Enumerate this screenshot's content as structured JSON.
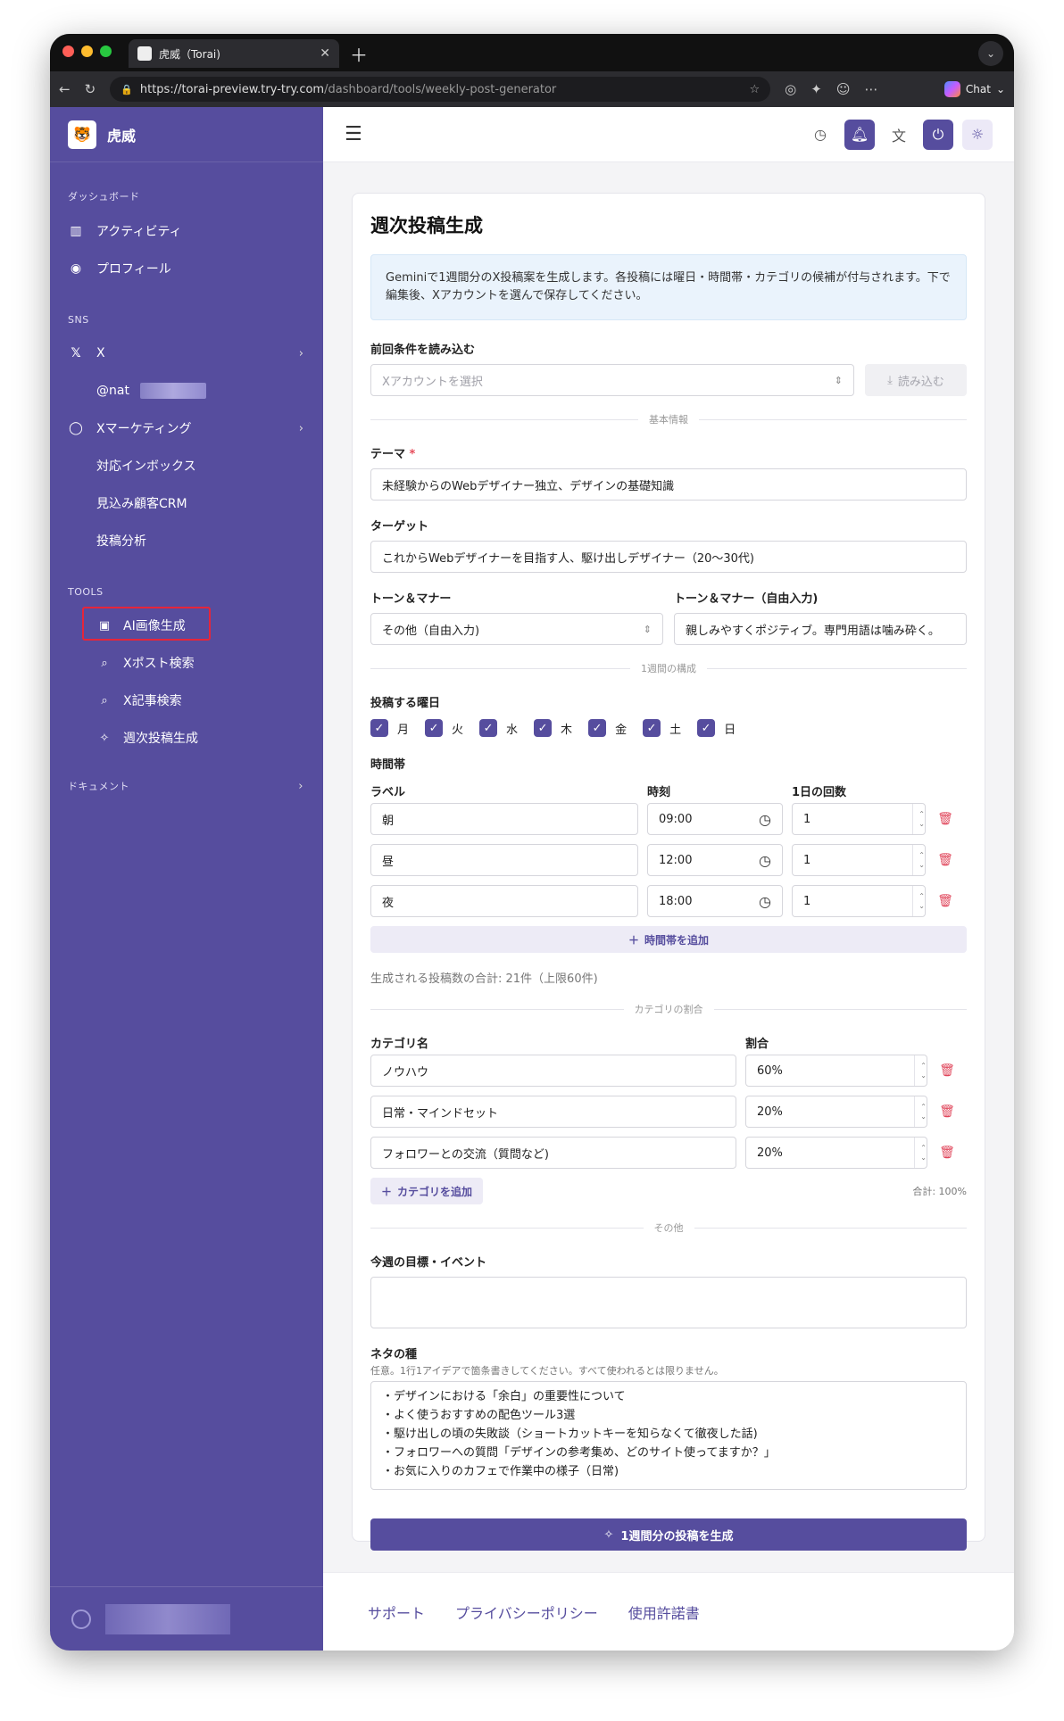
{
  "browser": {
    "tab_title": "虎威（Torai)",
    "url_host": "https://torai-preview.try-try.com",
    "url_path": "/dashboard/tools/weekly-post-generator",
    "chat_label": "Chat"
  },
  "sidebar": {
    "brand": "虎威",
    "section_dashboard": "ダッシュボード",
    "activity": "アクティビティ",
    "profile": "プロフィール",
    "section_sns": "SNS",
    "x": "X",
    "x_account": "@nat",
    "x_marketing": "Xマーケティング",
    "inbox": "対応インボックス",
    "crm": "見込み顧客CRM",
    "analytics": "投稿分析",
    "section_tools": "TOOLS",
    "ai_image": "AI画像生成",
    "x_post_search": "Xポスト検索",
    "x_article_search": "X記事検索",
    "weekly_post": "週次投稿生成",
    "documents": "ドキュメント"
  },
  "page": {
    "title": "週次投稿生成",
    "info": "Geminiで1週間分のX投稿案を生成します。各投稿には曜日・時間帯・カテゴリの候補が付与されます。下で編集後、Xアカウントを選んで保存してください。",
    "load_label": "前回条件を読み込む",
    "account_placeholder": "Xアカウントを選択",
    "load_button": "読み込む",
    "section_basic": "基本情報",
    "theme_label": "テーマ",
    "theme_value": "未経験からのWebデザイナー独立、デザインの基礎知識",
    "target_label": "ターゲット",
    "target_value": "これからWebデザイナーを目指す人、駆け出しデザイナー（20〜30代)",
    "tone_label": "トーン＆マナー",
    "tone_value": "その他（自由入力)",
    "tone_free_label": "トーン＆マナー（自由入力)",
    "tone_free_value": "親しみやすくポジティブ。専門用語は噛み砕く。",
    "section_week": "1週間の構成",
    "days_label": "投稿する曜日",
    "days": [
      "月",
      "火",
      "水",
      "木",
      "金",
      "土",
      "日"
    ],
    "timeslots_label": "時間帯",
    "col_label": "ラベル",
    "col_time": "時刻",
    "col_count": "1日の回数",
    "timeslots": [
      {
        "label": "朝",
        "time": "09:00",
        "count": "1"
      },
      {
        "label": "昼",
        "time": "12:00",
        "count": "1"
      },
      {
        "label": "夜",
        "time": "18:00",
        "count": "1"
      }
    ],
    "add_timeslot": "時間帯を追加",
    "total_posts": "生成される投稿数の合計: 21件（上限60件)",
    "section_category": "カテゴリの割合",
    "col_category": "カテゴリ名",
    "col_ratio": "割合",
    "categories": [
      {
        "name": "ノウハウ",
        "ratio": "60%"
      },
      {
        "name": "日常・マインドセット",
        "ratio": "20%"
      },
      {
        "name": "フォロワーとの交流（質問など)",
        "ratio": "20%"
      }
    ],
    "add_category": "カテゴリを追加",
    "ratio_total": "合計: 100%",
    "section_other": "その他",
    "goal_label": "今週の目標・イベント",
    "seeds_label": "ネタの種",
    "seeds_hint": "任意。1行1アイデアで箇条書きしてください。すべて使われるとは限りません。",
    "seeds": [
      "・デザインにおける「余白」の重要性について",
      "・よく使うおすすめの配色ツール3選",
      "・駆け出しの頃の失敗談（ショートカットキーを知らなくて徹夜した話)",
      "・フォロワーへの質問「デザインの参考集め、どのサイト使ってますか？」",
      "・お気に入りのカフェで作業中の様子（日常)"
    ],
    "generate_button": "1週間分の投稿を生成"
  },
  "footer": {
    "support": "サポート",
    "privacy": "プライバシーポリシー",
    "license": "使用許諾書"
  },
  "colors": {
    "brand": "#564d9e",
    "danger": "#e0455a",
    "highlight": "#e6253a"
  }
}
